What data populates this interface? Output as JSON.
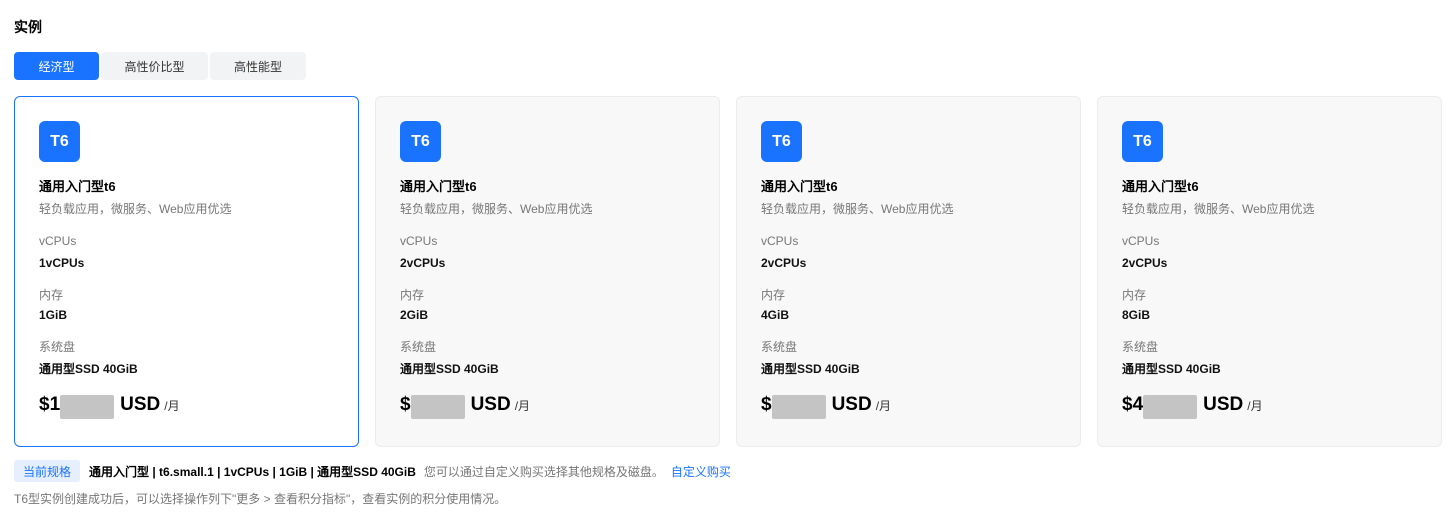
{
  "section": {
    "title": "实例"
  },
  "tabs": [
    {
      "label": "经济型",
      "active": true
    },
    {
      "label": "高性价比型",
      "active": false
    },
    {
      "label": "高性能型",
      "active": false
    }
  ],
  "cards": [
    {
      "badge": "T6",
      "title": "通用入门型t6",
      "description": "轻负载应用，微服务、Web应用优选",
      "vcpus_label": "vCPUs",
      "vcpus_value": "1vCPUs",
      "memory_label": "内存",
      "memory_value": "1GiB",
      "disk_label": "系统盘",
      "disk_value": "通用型SSD 40GiB",
      "price_currency": "$",
      "price_first_digit": "1",
      "price_unit": "USD",
      "price_period": "/月",
      "selected": true
    },
    {
      "badge": "T6",
      "title": "通用入门型t6",
      "description": "轻负载应用，微服务、Web应用优选",
      "vcpus_label": "vCPUs",
      "vcpus_value": "2vCPUs",
      "memory_label": "内存",
      "memory_value": "2GiB",
      "disk_label": "系统盘",
      "disk_value": "通用型SSD 40GiB",
      "price_currency": "$",
      "price_first_digit": "",
      "price_unit": "USD",
      "price_period": "/月",
      "selected": false
    },
    {
      "badge": "T6",
      "title": "通用入门型t6",
      "description": "轻负载应用，微服务、Web应用优选",
      "vcpus_label": "vCPUs",
      "vcpus_value": "2vCPUs",
      "memory_label": "内存",
      "memory_value": "4GiB",
      "disk_label": "系统盘",
      "disk_value": "通用型SSD 40GiB",
      "price_currency": "$",
      "price_first_digit": "",
      "price_unit": "USD",
      "price_period": "/月",
      "selected": false
    },
    {
      "badge": "T6",
      "title": "通用入门型t6",
      "description": "轻负载应用，微服务、Web应用优选",
      "vcpus_label": "vCPUs",
      "vcpus_value": "2vCPUs",
      "memory_label": "内存",
      "memory_value": "8GiB",
      "disk_label": "系统盘",
      "disk_value": "通用型SSD 40GiB",
      "price_currency": "$",
      "price_first_digit": "4",
      "price_unit": "USD",
      "price_period": "/月",
      "selected": false
    }
  ],
  "summary": {
    "tag": "当前规格",
    "spec": "通用入门型 |  t6.small.1 | 1vCPUs | 1GiB  | 通用型SSD 40GiB",
    "hint": "您可以通过自定义购买选择其他规格及磁盘。",
    "link": "自定义购买"
  },
  "footnote": "T6型实例创建成功后，可以选择操作列下\"更多 > 查看积分指标\"，查看实例的积分使用情况。",
  "colors": {
    "accent": "#1a73ff",
    "card_bg": "#f8f8f8",
    "muted_text": "#777777"
  }
}
